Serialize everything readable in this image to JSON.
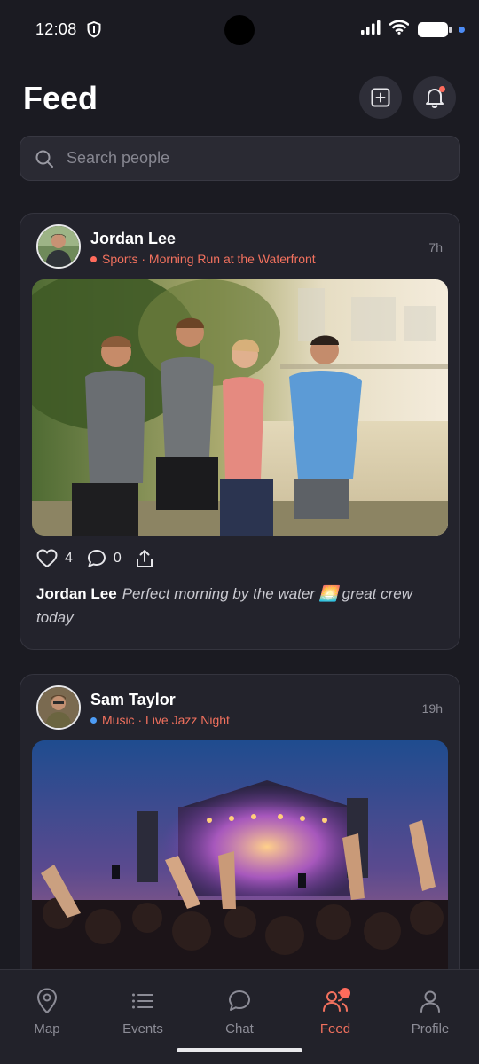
{
  "status_bar": {
    "time": "12:08",
    "icons": [
      "shield-icon",
      "signal-icon",
      "wifi-icon",
      "battery-icon"
    ]
  },
  "header": {
    "title": "Feed",
    "add_icon": "add-post-icon",
    "bell_icon": "bell-icon"
  },
  "search": {
    "placeholder": "Search people",
    "icon": "search-icon"
  },
  "posts": [
    {
      "author": "Jordan Lee",
      "category": "Sports",
      "event": "Morning Run at the Waterfront",
      "meta": "Sports · Morning Run at the Waterfront",
      "category_color": "#ff6b5c",
      "time": "7h",
      "likes": "4",
      "comments": "0",
      "caption_author": "Jordan Lee",
      "caption_text": "Perfect morning by the water 🌅 great crew today"
    },
    {
      "author": "Sam Taylor",
      "category": "Music",
      "event": "Live Jazz Night",
      "meta": "Music · Live Jazz Night",
      "category_color": "#4d9cf5",
      "time": "19h"
    }
  ],
  "nav": {
    "items": [
      {
        "label": "Map",
        "icon": "map-pin-icon",
        "active": false
      },
      {
        "label": "Events",
        "icon": "list-icon",
        "active": false
      },
      {
        "label": "Chat",
        "icon": "chat-bubble-icon",
        "active": false
      },
      {
        "label": "Feed",
        "icon": "people-icon",
        "active": true
      },
      {
        "label": "Profile",
        "icon": "person-icon",
        "active": false
      }
    ]
  },
  "colors": {
    "background": "#1b1b22",
    "card": "#23232c",
    "accent": "#f2715e",
    "notification": "#ff6b5c"
  }
}
